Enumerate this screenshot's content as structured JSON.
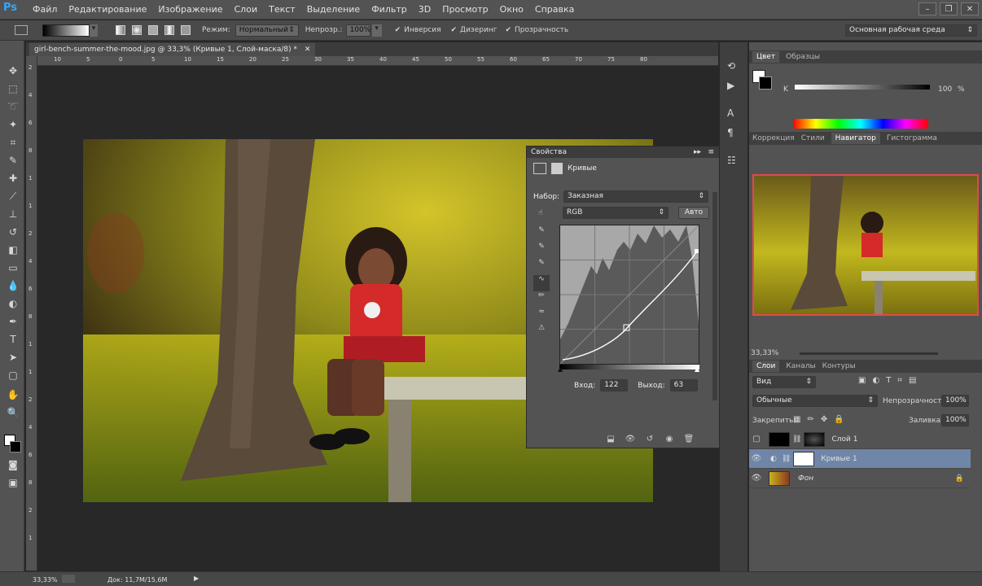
{
  "app": {
    "logo": "Ps"
  },
  "menu": [
    "Файл",
    "Редактирование",
    "Изображение",
    "Слои",
    "Текст",
    "Выделение",
    "Фильтр",
    "3D",
    "Просмотр",
    "Окно",
    "Справка"
  ],
  "window_buttons": [
    "–",
    "❐",
    "✕"
  ],
  "options": {
    "mode_label": "Режим:",
    "mode_value": "Нормальный",
    "opacity_label": "Непрозр.:",
    "opacity_value": "100%",
    "inversion": "Инверсия",
    "dither": "Дизеринг",
    "transparency": "Прозрачность",
    "workspace": "Основная рабочая среда"
  },
  "document": {
    "tab_title": "girl-bench-summer-the-mood.jpg @ 33,3% (Кривые 1, Слой-маска/8) *",
    "close": "✕",
    "ruler_ticks_h": [
      "10",
      "5",
      "0",
      "5",
      "10",
      "15",
      "20",
      "25",
      "30",
      "35",
      "40",
      "45",
      "50",
      "55",
      "60",
      "65",
      "70",
      "75",
      "80"
    ],
    "ruler_ticks_v": [
      "2",
      "4",
      "6",
      "8",
      "1",
      "1",
      "2",
      "4",
      "6",
      "8",
      "1",
      "1",
      "2",
      "4",
      "6",
      "8",
      "2",
      "1"
    ]
  },
  "properties": {
    "panel_title": "Свойства",
    "adjustment_name": "Кривые",
    "preset_label": "Набор:",
    "preset_value": "Заказная",
    "channel_value": "RGB",
    "auto_button": "Авто",
    "input_label": "Вход:",
    "input_value": "122",
    "output_label": "Выход:",
    "output_value": "63"
  },
  "color_panel": {
    "tabs": [
      "Цвет",
      "Образцы"
    ],
    "k_label": "K",
    "k_value": "100",
    "k_unit": "%"
  },
  "navigator_panel": {
    "tabs": [
      "Коррекция",
      "Стили",
      "Навигатор",
      "Гистограмма"
    ],
    "zoom": "33,33%"
  },
  "layers_panel": {
    "tabs": [
      "Слои",
      "Каналы",
      "Контуры"
    ],
    "filter_value": "Вид",
    "blend_value": "Обычные",
    "opacity_label": "Непрозрачность:",
    "opacity_value": "100%",
    "lock_label": "Закрепить:",
    "fill_label": "Заливка:",
    "fill_value": "100%",
    "layers": [
      {
        "name": "Слой 1",
        "visible": false
      },
      {
        "name": "Кривые 1",
        "visible": true,
        "selected": true
      },
      {
        "name": "Фон",
        "visible": true,
        "locked": true
      }
    ]
  },
  "status": {
    "zoom": "33,33%",
    "doc_info": "Док: 11,7M/15,6M"
  },
  "colors": {
    "accent_selected_layer": "#6f86a8",
    "navigator_frame": "#e04a4a",
    "ps_blue": "#31a8ff"
  }
}
